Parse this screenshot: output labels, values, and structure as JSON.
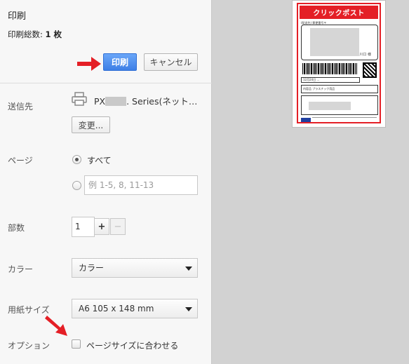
{
  "header": {
    "title": "印刷",
    "total_label": "印刷総数:",
    "total_value": "1 枚"
  },
  "actions": {
    "print_label": "印刷",
    "cancel_label": "キャンセル"
  },
  "destination": {
    "label": "送信先",
    "printer_prefix": "PX",
    "printer_suffix": ". Series(ネット…",
    "change_label": "変更..."
  },
  "pages": {
    "label": "ページ",
    "all_label": "すべて",
    "custom_placeholder": "例 1-5, 8, 11-13",
    "selected": "all"
  },
  "copies": {
    "label": "部数",
    "value": "1",
    "plus": "+",
    "minus": "−"
  },
  "color": {
    "label": "カラー",
    "value": "カラー"
  },
  "paper": {
    "label": "用紙サイズ",
    "value": "A6 105 x 148 mm"
  },
  "options": {
    "label": "オプション",
    "fit_label": "ページサイズに合わせる",
    "fit_checked": false
  },
  "preview": {
    "header_text": "クリックポスト",
    "caption": "(配送先) 郵便番号〒",
    "sama": "川口 様",
    "date_text": "12月24日 ...",
    "content_text": "内容品 プラスチック用品"
  },
  "colors": {
    "accent_blue": "#3d7fe6",
    "arrow_red": "#e41f26"
  }
}
